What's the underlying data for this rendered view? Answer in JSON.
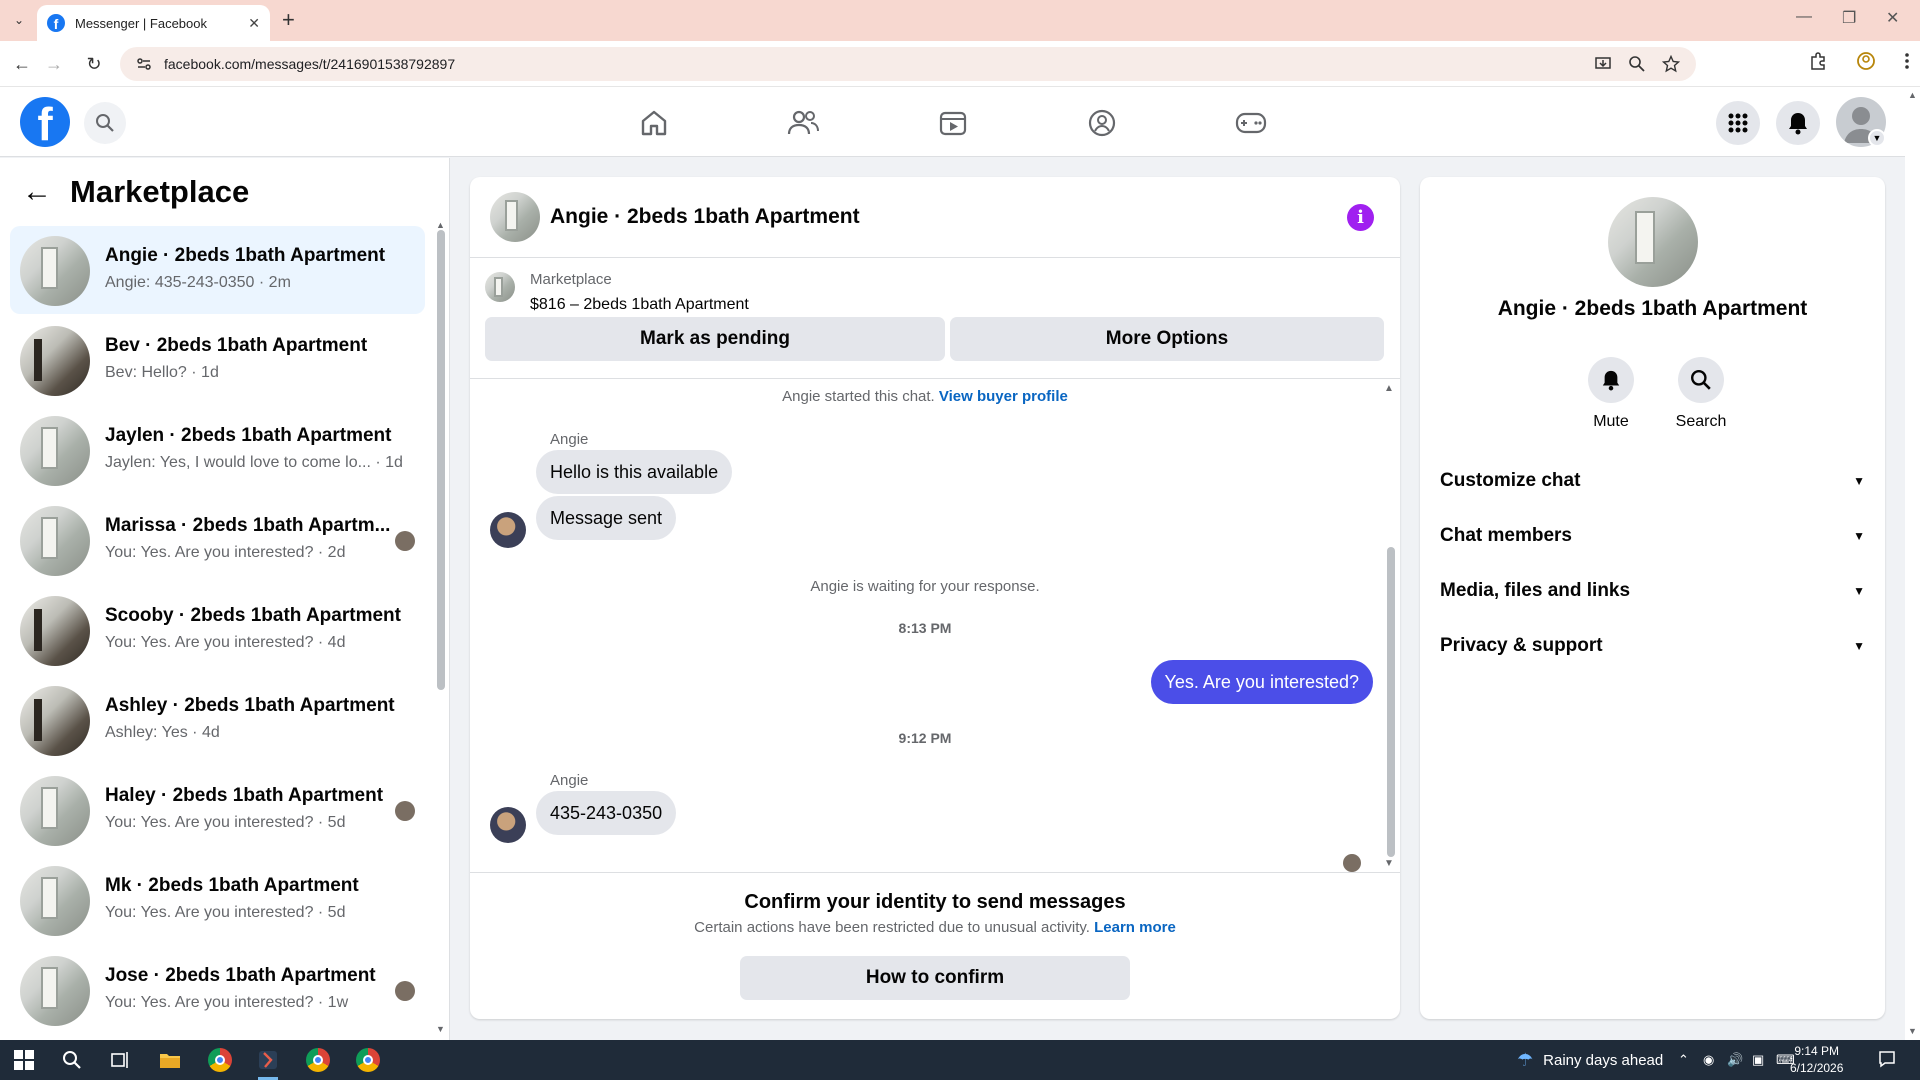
{
  "browser": {
    "tab_title": "Messenger | Facebook",
    "url": "facebook.com/messages/t/2416901538792897"
  },
  "header": {
    "logo": "f"
  },
  "left": {
    "title": "Marketplace",
    "conversations": [
      {
        "name": "Angie · 2beds 1bath Apartment",
        "preview": "Angie: 435-243-0350 · 2m",
        "thumb": "room",
        "active": true
      },
      {
        "name": "Bev · 2beds 1bath Apartment",
        "preview": "Bev: Hello? · 1d",
        "thumb": "dark"
      },
      {
        "name": "Jaylen · 2beds 1bath Apartment",
        "preview": "Jaylen: Yes, I would love to come lo... · 1d",
        "thumb": "room"
      },
      {
        "name": "Marissa · 2beds 1bath Apartm...",
        "preview": "You: Yes. Are you interested? · 2d",
        "thumb": "room",
        "seen": true
      },
      {
        "name": "Scooby · 2beds 1bath Apartment",
        "preview": "You: Yes. Are you interested? · 4d",
        "thumb": "dark"
      },
      {
        "name": "Ashley · 2beds 1bath Apartment",
        "preview": "Ashley: Yes · 4d",
        "thumb": "dark"
      },
      {
        "name": "Haley · 2beds 1bath Apartment",
        "preview": "You: Yes. Are you interested? · 5d",
        "thumb": "room",
        "seen": true
      },
      {
        "name": "Mk · 2beds 1bath Apartment",
        "preview": "You: Yes. Are you interested? · 5d",
        "thumb": "room"
      },
      {
        "name": "Jose · 2beds 1bath Apartment",
        "preview": "You: Yes. Are you interested? · 1w",
        "thumb": "room",
        "seen": true
      }
    ]
  },
  "chat": {
    "title": "Angie · 2beds 1bath Apartment",
    "listing_category": "Marketplace",
    "listing_price": "$816 – 2beds 1bath Apartment",
    "btn_pending": "Mark as pending",
    "btn_more": "More Options",
    "started_text": "Angie started this chat.",
    "view_profile": "View buyer profile",
    "sender": "Angie",
    "msg1": "Hello is this available",
    "msg2": "Message sent",
    "waiting": "Angie is waiting for your response.",
    "time1": "8:13 PM",
    "msg_out": "Yes. Are you interested?",
    "time2": "9:12 PM",
    "msg3": "435-243-0350",
    "confirm_title": "Confirm your identity to send messages",
    "confirm_text": "Certain actions have been restricted due to unusual activity.",
    "learn_more": "Learn more",
    "how_to_confirm": "How to confirm"
  },
  "right": {
    "name": "Angie · 2beds 1bath Apartment",
    "mute": "Mute",
    "search": "Search",
    "sections": [
      "Customize chat",
      "Chat members",
      "Media, files and links",
      "Privacy & support"
    ]
  },
  "taskbar": {
    "weather": "Rainy days ahead",
    "time": "9:14 PM",
    "date": "6/12/2026"
  }
}
